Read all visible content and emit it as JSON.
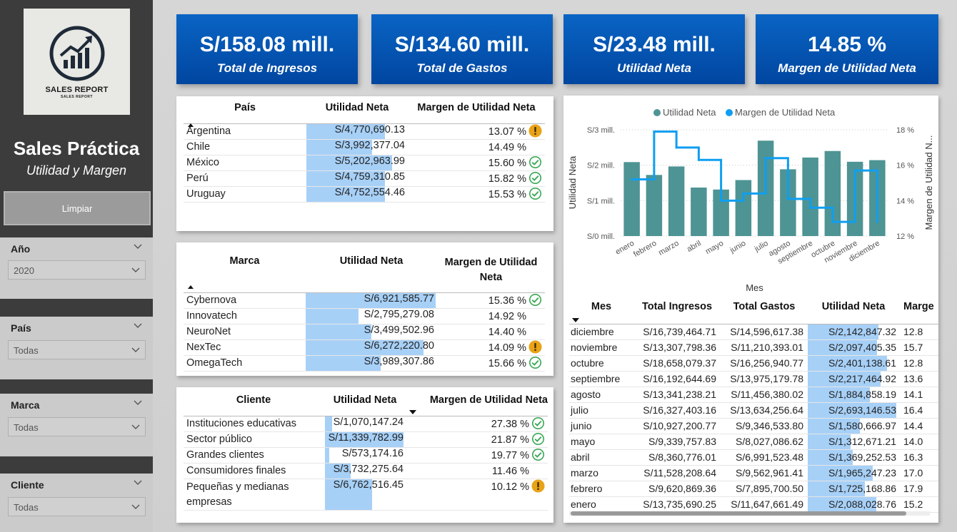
{
  "sidebar": {
    "logo": {
      "title": "SALES REPORT",
      "subtitle": "SALES REPORT"
    },
    "title": "Sales Práctica",
    "subtitle": "Utilidad y Margen",
    "clear_label": "Limpiar",
    "slicers": [
      {
        "label": "Año",
        "value": "2020"
      },
      {
        "label": "País",
        "value": "Todas"
      },
      {
        "label": "Marca",
        "value": "Todas"
      },
      {
        "label": "Cliente",
        "value": "Todas"
      }
    ]
  },
  "kpis": [
    {
      "value": "S/158.08 mill.",
      "label": "Total de Ingresos"
    },
    {
      "value": "S/134.60 mill.",
      "label": "Total de Gastos"
    },
    {
      "value": "S/23.48 mill.",
      "label": "Utilidad Neta"
    },
    {
      "value": "14.85 %",
      "label": "Margen de Utilidad Neta"
    }
  ],
  "pais_table": {
    "headers": [
      "País",
      "Utilidad Neta",
      "Margen de Utilidad Neta"
    ],
    "rows": [
      {
        "name": "Argentina",
        "value": "S/4,770,690.13",
        "bar": 0.917,
        "margin": "13.07 %",
        "icon": "warning"
      },
      {
        "name": "Chile",
        "value": "S/3,992,377.04",
        "bar": 0.767,
        "margin": "14.49 %",
        "icon": "none"
      },
      {
        "name": "México",
        "value": "S/5,202,963.99",
        "bar": 1.0,
        "margin": "15.60 %",
        "icon": "check"
      },
      {
        "name": "Perú",
        "value": "S/4,759,310.85",
        "bar": 0.915,
        "margin": "15.82 %",
        "icon": "check"
      },
      {
        "name": "Uruguay",
        "value": "S/4,752,554.46",
        "bar": 0.913,
        "margin": "15.53 %",
        "icon": "check"
      }
    ]
  },
  "marca_table": {
    "headers": [
      "Marca",
      "Utilidad Neta",
      "Margen de Utilidad Neta"
    ],
    "rows": [
      {
        "name": "Cybernova",
        "value": "S/6,921,585.77",
        "bar": 1.0,
        "margin": "15.36 %",
        "icon": "check"
      },
      {
        "name": "Innovatech",
        "value": "S/2,795,279.08",
        "bar": 0.404,
        "margin": "14.92 %",
        "icon": "none"
      },
      {
        "name": "NeuroNet",
        "value": "S/3,499,502.96",
        "bar": 0.506,
        "margin": "14.40 %",
        "icon": "none"
      },
      {
        "name": "NexTec",
        "value": "S/6,272,220.80",
        "bar": 0.906,
        "margin": "14.09 %",
        "icon": "warning"
      },
      {
        "name": "OmegaTech",
        "value": "S/3,989,307.86",
        "bar": 0.576,
        "margin": "15.66 %",
        "icon": "check"
      }
    ]
  },
  "cliente_table": {
    "headers": [
      "Cliente",
      "Utilidad Neta",
      "Margen de Utilidad Neta"
    ],
    "rows": [
      {
        "name": "Instituciones educativas",
        "value": "S/1,070,147.24",
        "bar": 0.094,
        "margin": "27.38 %",
        "icon": "check"
      },
      {
        "name": "Sector público",
        "value": "S/11,339,782.99",
        "bar": 1.0,
        "margin": "21.87 %",
        "icon": "check"
      },
      {
        "name": "Grandes clientes",
        "value": "S/573,174.16",
        "bar": 0.051,
        "margin": "19.77 %",
        "icon": "check"
      },
      {
        "name": "Consumidores finales",
        "value": "S/3,732,275.64",
        "bar": 0.329,
        "margin": "11.46 %",
        "icon": "none"
      },
      {
        "name": "Pequeñas y medianas empresas",
        "value": "S/6,762,516.45",
        "bar": 0.596,
        "margin": "10.12 %",
        "icon": "warning"
      }
    ]
  },
  "chart_data": {
    "type": "bar",
    "title": "",
    "legend": [
      "Utilidad Neta",
      "Margen de Utilidad Neta"
    ],
    "legend_position": "top",
    "xlabel": "Mes",
    "ylabel": "Utilidad Neta",
    "y2label": "Margen de Utilidad N...",
    "categories": [
      "enero",
      "febrero",
      "marzo",
      "abril",
      "mayo",
      "junio",
      "julio",
      "agosto",
      "septiembre",
      "octubre",
      "noviembre",
      "diciembre"
    ],
    "series": [
      {
        "name": "Utilidad Neta",
        "type": "bar",
        "axis": "left",
        "color": "#4e9494",
        "values": [
          2.088,
          1.725,
          1.965,
          1.369,
          1.313,
          1.581,
          2.693,
          1.885,
          2.217,
          2.401,
          2.097,
          2.143
        ]
      },
      {
        "name": "Margen de Utilidad Neta",
        "type": "step-line",
        "axis": "right",
        "color": "#0f9ef0",
        "values": [
          15.2,
          17.9,
          17.0,
          16.3,
          14.0,
          14.4,
          16.4,
          14.1,
          13.6,
          12.8,
          15.7,
          12.8
        ]
      }
    ],
    "ylim": [
      0,
      3
    ],
    "y2lim": [
      12,
      18
    ],
    "yticks": [
      "S/0 mill.",
      "S/1 mill.",
      "S/2 mill.",
      "S/3 mill."
    ],
    "y2ticks": [
      "12 %",
      "14 %",
      "16 %",
      "18 %"
    ]
  },
  "mes_table": {
    "headers": [
      "Mes",
      "Total Ingresos",
      "Total Gastos",
      "Utilidad Neta",
      "Marge"
    ],
    "rows": [
      {
        "mes": "diciembre",
        "ingresos": "S/16,739,464.71",
        "gastos": "S/14,596,617.38",
        "utilidad": "S/2,142,847.32",
        "bar": 0.796,
        "margen": "12.8"
      },
      {
        "mes": "noviembre",
        "ingresos": "S/13,307,798.36",
        "gastos": "S/11,210,393.01",
        "utilidad": "S/2,097,405.35",
        "bar": 0.779,
        "margen": "15.7"
      },
      {
        "mes": "octubre",
        "ingresos": "S/18,658,079.37",
        "gastos": "S/16,256,940.77",
        "utilidad": "S/2,401,138.61",
        "bar": 0.892,
        "margen": "12.8"
      },
      {
        "mes": "septiembre",
        "ingresos": "S/16,192,644.69",
        "gastos": "S/13,975,179.78",
        "utilidad": "S/2,217,464.92",
        "bar": 0.823,
        "margen": "13.6"
      },
      {
        "mes": "agosto",
        "ingresos": "S/13,341,238.21",
        "gastos": "S/11,456,380.02",
        "utilidad": "S/1,884,858.19",
        "bar": 0.7,
        "margen": "14.1"
      },
      {
        "mes": "julio",
        "ingresos": "S/16,327,403.16",
        "gastos": "S/13,634,256.64",
        "utilidad": "S/2,693,146.53",
        "bar": 1.0,
        "margen": "16.4"
      },
      {
        "mes": "junio",
        "ingresos": "S/10,927,200.77",
        "gastos": "S/9,346,533.80",
        "utilidad": "S/1,580,666.97",
        "bar": 0.587,
        "margen": "14.4"
      },
      {
        "mes": "mayo",
        "ingresos": "S/9,339,757.83",
        "gastos": "S/8,027,086.62",
        "utilidad": "S/1,312,671.21",
        "bar": 0.487,
        "margen": "14.0"
      },
      {
        "mes": "abril",
        "ingresos": "S/8,360,776.01",
        "gastos": "S/6,991,523.48",
        "utilidad": "S/1,369,252.53",
        "bar": 0.508,
        "margen": "16.3"
      },
      {
        "mes": "marzo",
        "ingresos": "S/11,528,208.64",
        "gastos": "S/9,562,961.41",
        "utilidad": "S/1,965,247.23",
        "bar": 0.73,
        "margen": "17.0"
      },
      {
        "mes": "febrero",
        "ingresos": "S/9,620,869.36",
        "gastos": "S/7,895,700.50",
        "utilidad": "S/1,725,168.86",
        "bar": 0.641,
        "margen": "17.9"
      },
      {
        "mes": "enero",
        "ingresos": "S/13,735,690.25",
        "gastos": "S/11,647,661.49",
        "utilidad": "S/2,088,028.76",
        "bar": 0.775,
        "margen": "15.2"
      }
    ]
  },
  "colors": {
    "kpi_blue": "#0055b3",
    "bar_teal": "#4e9494",
    "line_blue": "#0f9ef0",
    "table_bar": "#a7d0f7",
    "check_green": "#3aa856",
    "warning_orange": "#e8a317"
  }
}
